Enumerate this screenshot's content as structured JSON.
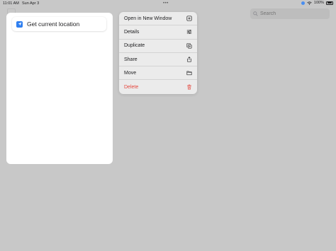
{
  "status_bar": {
    "time": "11:01 AM",
    "date": "Sun Apr 3",
    "battery": "100%",
    "icons": [
      "location-icon",
      "wifi-icon",
      "battery-icon"
    ],
    "multitask_dots": "•••"
  },
  "search": {
    "placeholder": "Search",
    "value": "",
    "icon": "search-icon"
  },
  "shortcut_editor": {
    "action": {
      "label": "Get current location",
      "icon": "location-arrow-icon",
      "icon_color": "#2f7ff0"
    }
  },
  "context_menu": {
    "items": [
      {
        "label": "Open in New Window",
        "icon": "new-window-icon"
      },
      {
        "label": "Details",
        "icon": "sliders-icon"
      },
      {
        "label": "Duplicate",
        "icon": "duplicate-icon"
      },
      {
        "label": "Share",
        "icon": "share-icon"
      },
      {
        "label": "Move",
        "icon": "folder-icon"
      },
      {
        "label": "Delete",
        "icon": "trash-icon",
        "destructive": true,
        "color": "#e5463d"
      }
    ]
  }
}
